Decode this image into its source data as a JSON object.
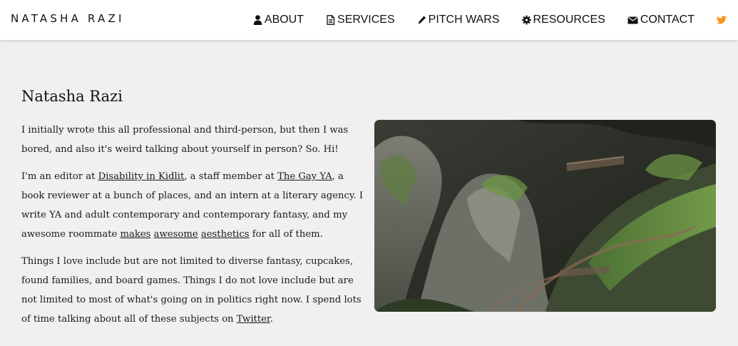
{
  "header": {
    "brand": "NATASHA RAZI",
    "nav": [
      {
        "label": "ABOUT",
        "icon": "user-icon"
      },
      {
        "label": "SERVICES",
        "icon": "document-icon"
      },
      {
        "label": "PITCH WARS",
        "icon": "pencil-icon"
      },
      {
        "label": "RESOURCES",
        "icon": "gear-icon"
      },
      {
        "label": "CONTACT",
        "icon": "envelope-icon"
      }
    ],
    "social_icon": "twitter-icon",
    "accent_color": "#f7931e"
  },
  "main": {
    "title": "Natasha Razi",
    "p1": "I initially wrote this all professional and third-person, but then I was bored, and also it's weird talking about yourself in person? So. Hi!",
    "p2": {
      "t1": "I'm an editor at ",
      "link1": "Disability in Kidlit",
      "t2": ", a staff member at ",
      "link2": "The Gay YA",
      "t3": ", a book reviewer at a bunch of places, and an intern at a literary agency. I write YA and adult contemporary and contemporary fantasy, and my awesome roommate ",
      "link3": "makes",
      "t4": " ",
      "link4": "awesome",
      "t5": " ",
      "link5": "aesthetics",
      "t6": " for all of them."
    },
    "p3": {
      "t1": "Things I love include but are not limited to diverse fantasy, cupcakes, found families, and board games. Things I do not love include but are not limited to most of what's going on in politics right now. I spend lots of time talking about all of these subjects on ",
      "link1": "Twitter",
      "t2": "."
    },
    "photo_subject": "cave-photo"
  }
}
